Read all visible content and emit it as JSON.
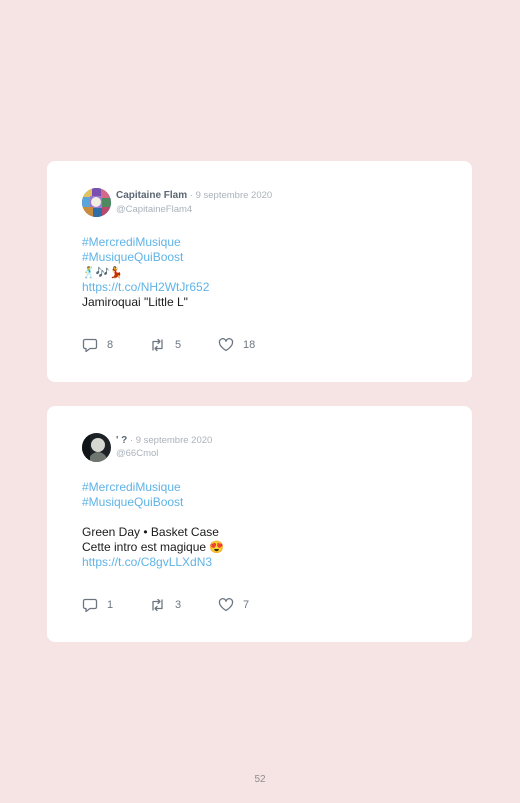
{
  "tweets": [
    {
      "author_name": "Capitaine Flam",
      "date": " · 9 septembre 2020",
      "handle": "@CapitaineFlam4",
      "lines": [
        "#MercrediMusique",
        "#MusiqueQuiBoost",
        "🕺🎶💃",
        "https://t.co/NH2WtJr652",
        "Jamiroquai \"Little L\""
      ],
      "replies": "8",
      "retweets": "5",
      "likes": "18",
      "avatar_icon": "colorful-mosaic-avatar"
    },
    {
      "author_name": "' ?",
      "date": " · 9 septembre 2020",
      "handle": "@66Cmol",
      "lines": [
        "#MercrediMusique",
        "#MusiqueQuiBoost",
        "",
        "Green Day • Basket Case",
        "Cette intro est magique 😍",
        "https://t.co/C8gvLLXdN3"
      ],
      "replies": "1",
      "retweets": "3",
      "likes": "7",
      "avatar_icon": "dark-portrait-avatar"
    }
  ],
  "page_number": "52",
  "colors": {
    "background": "#f5e4e3",
    "card": "#ffffff",
    "link": "#5fb3e6",
    "muted": "#a9b2bb"
  }
}
